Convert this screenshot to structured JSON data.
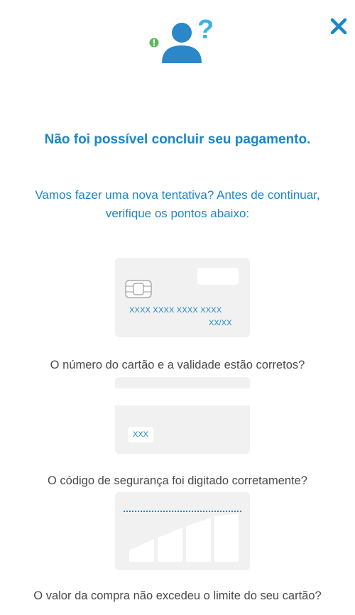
{
  "close": {
    "icon": "close-icon"
  },
  "header": {
    "icon": "user-question-icon",
    "title": "Não foi possível concluir seu pagamento.",
    "subtitle_line1": "Vamos fazer uma nova tentativa? Antes de continuar,",
    "subtitle_line2": "verifique os pontos abaixo:"
  },
  "checks": [
    {
      "card_number": "XXXX XXXX XXXX XXXX",
      "card_expiry": "XX/XX",
      "question": "O número do cartão e a validade estão corretos?"
    },
    {
      "cvv": "XXX",
      "question": "O código de segurança foi digitado corretamente?"
    },
    {
      "question": "O valor da compra não excedeu o limite do seu cartão?"
    }
  ],
  "colors": {
    "accent": "#1a87c9",
    "text": "#4a4a4a",
    "card_bg": "#f1f1f1",
    "badge": "#5cb85c"
  }
}
